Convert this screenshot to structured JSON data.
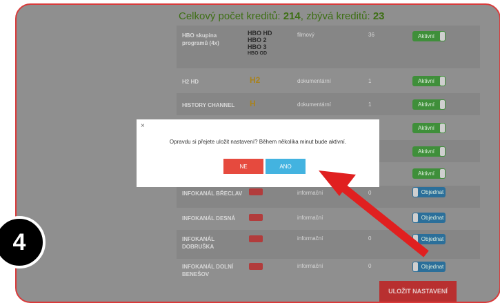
{
  "header": {
    "credits_prefix": "Celkový počet kreditů: ",
    "credits_total": "214",
    "credits_middle": ", zbývá kreditů: ",
    "credits_left": "23"
  },
  "channels": [
    {
      "name": "HBO skupina programů (4x)",
      "genre": "filmový",
      "credits": "36",
      "status": "Aktivní",
      "logo": "hbo-group-logo",
      "logo_text": [
        "HBO HD",
        "HBO 2",
        "HBO 3",
        "HBO OD"
      ]
    },
    {
      "name": "H2 HD",
      "genre": "dokumentární",
      "credits": "1",
      "status": "Aktivní",
      "logo": "h2-logo",
      "logo_text": "H2"
    },
    {
      "name": "HISTORY CHANNEL",
      "genre": "dokumentární",
      "credits": "1",
      "status": "Aktivní",
      "logo": "history-logo",
      "logo_text": "H"
    },
    {
      "name": "",
      "genre": "",
      "credits": "",
      "status": "Aktivní"
    },
    {
      "name": "",
      "genre": "",
      "credits": "",
      "status": "Aktivní"
    },
    {
      "name": "",
      "genre": "",
      "credits": "",
      "status": "Aktivní"
    },
    {
      "name": "INFOKANÁL BŘECLAV",
      "genre": "informační",
      "credits": "0",
      "status": "Objednat",
      "logo": "infokanal-logo"
    },
    {
      "name": "INFOKANÁL DESNÁ",
      "genre": "informační",
      "credits": "",
      "status": "Objednat",
      "logo": "infokanal-logo"
    },
    {
      "name": "INFOKANÁL DOBRUŠKA",
      "genre": "informační",
      "credits": "0",
      "status": "Objednat",
      "logo": "infokanal-logo"
    },
    {
      "name": "INFOKANÁL DOLNÍ BENEŠOV",
      "genre": "informační",
      "credits": "0",
      "status": "Objednat",
      "logo": "infokanal-logo"
    }
  ],
  "footer": {
    "save_label": "ULOŽIT NASTAVENÍ"
  },
  "modal": {
    "close": "×",
    "message": "Opravdu si přejete uložit nastavení? Během několika minut bude aktivní.",
    "no_label": "NE",
    "yes_label": "ANO"
  },
  "annotation": {
    "step_number": "4",
    "arrow_color": "#e02020"
  }
}
